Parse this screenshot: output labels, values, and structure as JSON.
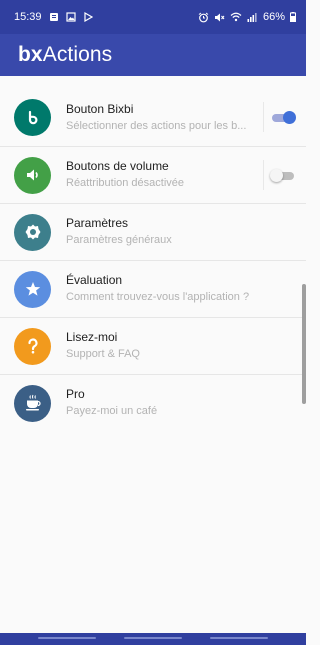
{
  "status_bar": {
    "time": "15:39",
    "battery": "66%",
    "left_icons": [
      "notification-icon",
      "image-icon",
      "play-store-icon"
    ],
    "right_icons": [
      "alarm-icon",
      "mute-icon",
      "wifi-icon",
      "signal-icon",
      "battery-icon"
    ]
  },
  "app_bar": {
    "title_bold": "bx",
    "title_rest": "Actions"
  },
  "items": [
    {
      "title": "Bouton Bixbi",
      "subtitle": "Sélectionner des actions pour les b...",
      "icon": "bixby-icon",
      "color": "#00796b",
      "switch": "on"
    },
    {
      "title": "Boutons de volume",
      "subtitle": "Réattribution désactivée",
      "icon": "volume-icon",
      "color": "#43a047",
      "switch": "off"
    },
    {
      "title": "Paramètres",
      "subtitle": "Paramètres généraux",
      "icon": "settings-icon",
      "color": "#3d7f8c"
    },
    {
      "title": "Évaluation",
      "subtitle": "Comment trouvez-vous l'application ?",
      "icon": "star-icon",
      "color": "#5b8ee0"
    },
    {
      "title": "Lisez-moi",
      "subtitle": "Support & FAQ",
      "icon": "question-icon",
      "color": "#f29a1d"
    },
    {
      "title": "Pro",
      "subtitle": "Payez-moi un café",
      "icon": "coffee-icon",
      "color": "#3b5f86"
    }
  ]
}
